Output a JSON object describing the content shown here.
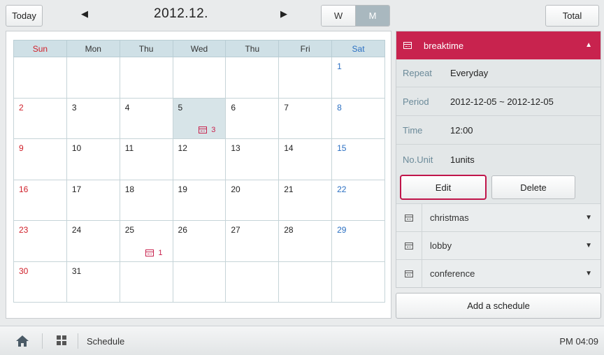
{
  "toolbar": {
    "today_label": "Today",
    "month_title": "2012.12.",
    "prev_icon": "triangle-left-icon",
    "next_icon": "triangle-right-icon",
    "week_label": "W",
    "month_label": "M",
    "total_label": "Total"
  },
  "calendar": {
    "weekdays": [
      "Sun",
      "Mon",
      "Thu",
      "Wed",
      "Thu",
      "Fri",
      "Sat"
    ],
    "weeks": [
      [
        "",
        "",
        "",
        "",
        "",
        "",
        "1"
      ],
      [
        "2",
        "3",
        "4",
        "5",
        "6",
        "7",
        "8"
      ],
      [
        "9",
        "10",
        "11",
        "12",
        "13",
        "14",
        "15"
      ],
      [
        "16",
        "17",
        "18",
        "19",
        "20",
        "21",
        "22"
      ],
      [
        "23",
        "24",
        "25",
        "26",
        "27",
        "28",
        "29"
      ],
      [
        "30",
        "31",
        "",
        "",
        "",
        "",
        ""
      ]
    ],
    "markers": {
      "5": "3",
      "25": "1"
    },
    "selected_day": "5",
    "sunday_color": "#d0202a",
    "saturday_color": "#2a6fc2",
    "marker_color": "#c8234e"
  },
  "detail": {
    "title": "breaktime",
    "header_color": "#c8234e",
    "rows": [
      {
        "label": "Repeat",
        "value": "Everyday"
      },
      {
        "label": "Period",
        "value": "2012-12-05 ~ 2012-12-05"
      },
      {
        "label": "Time",
        "value": "12:00"
      },
      {
        "label": "No.Unit",
        "value": "1units"
      }
    ],
    "edit_label": "Edit",
    "delete_label": "Delete",
    "schedules": [
      "christmas",
      "lobby",
      "conference"
    ]
  },
  "add_schedule_label": "Add a schedule",
  "bottom": {
    "label": "Schedule",
    "clock": "PM 04:09"
  }
}
